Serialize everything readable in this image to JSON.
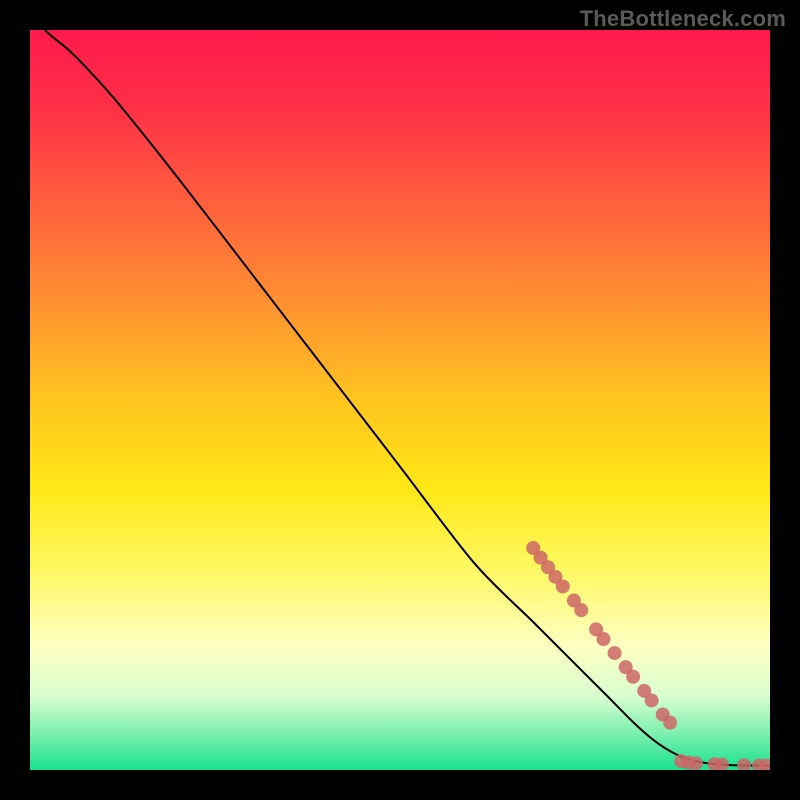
{
  "watermark": "TheBottleneck.com",
  "chart_data": {
    "type": "line",
    "title": "",
    "xlabel": "",
    "ylabel": "",
    "xlim": [
      0,
      100
    ],
    "ylim": [
      0,
      100
    ],
    "background_gradient_stops": [
      {
        "offset": 0.0,
        "color": "#ff1a4b"
      },
      {
        "offset": 0.1,
        "color": "#ff2e47"
      },
      {
        "offset": 0.22,
        "color": "#ff5a3e"
      },
      {
        "offset": 0.35,
        "color": "#ff8a33"
      },
      {
        "offset": 0.5,
        "color": "#ffc41f"
      },
      {
        "offset": 0.62,
        "color": "#ffe816"
      },
      {
        "offset": 0.73,
        "color": "#fff863"
      },
      {
        "offset": 0.83,
        "color": "#ffffc0"
      },
      {
        "offset": 0.9,
        "color": "#d9ffd0"
      },
      {
        "offset": 0.95,
        "color": "#7df0b0"
      },
      {
        "offset": 1.0,
        "color": "#19e28e"
      }
    ],
    "curve": [
      {
        "x": 2,
        "y": 100
      },
      {
        "x": 3,
        "y": 99
      },
      {
        "x": 5,
        "y": 97.5
      },
      {
        "x": 8,
        "y": 94.5
      },
      {
        "x": 12,
        "y": 90
      },
      {
        "x": 20,
        "y": 80
      },
      {
        "x": 30,
        "y": 67
      },
      {
        "x": 40,
        "y": 54
      },
      {
        "x": 50,
        "y": 41
      },
      {
        "x": 60,
        "y": 28
      },
      {
        "x": 68,
        "y": 20
      },
      {
        "x": 74,
        "y": 14
      },
      {
        "x": 78,
        "y": 10
      },
      {
        "x": 82,
        "y": 6
      },
      {
        "x": 85,
        "y": 3.5
      },
      {
        "x": 88,
        "y": 1.8
      },
      {
        "x": 91,
        "y": 1.0
      },
      {
        "x": 94,
        "y": 0.7
      },
      {
        "x": 97,
        "y": 0.6
      },
      {
        "x": 100,
        "y": 0.6
      }
    ],
    "highlight_points": [
      {
        "x": 68,
        "y": 30
      },
      {
        "x": 69,
        "y": 28.7
      },
      {
        "x": 70,
        "y": 27.4
      },
      {
        "x": 71,
        "y": 26.1
      },
      {
        "x": 72,
        "y": 24.8
      },
      {
        "x": 73.5,
        "y": 22.9
      },
      {
        "x": 74.5,
        "y": 21.6
      },
      {
        "x": 76.5,
        "y": 19.0
      },
      {
        "x": 77.5,
        "y": 17.7
      },
      {
        "x": 79,
        "y": 15.8
      },
      {
        "x": 80.5,
        "y": 13.9
      },
      {
        "x": 81.5,
        "y": 12.6
      },
      {
        "x": 83,
        "y": 10.7
      },
      {
        "x": 84,
        "y": 9.4
      },
      {
        "x": 85.5,
        "y": 7.5
      },
      {
        "x": 86.5,
        "y": 6.4
      },
      {
        "x": 88,
        "y": 1.2
      },
      {
        "x": 89,
        "y": 1.0
      },
      {
        "x": 90,
        "y": 0.9
      },
      {
        "x": 92.5,
        "y": 0.8
      },
      {
        "x": 93.5,
        "y": 0.75
      },
      {
        "x": 96.5,
        "y": 0.65
      },
      {
        "x": 98.5,
        "y": 0.6
      },
      {
        "x": 99.5,
        "y": 0.6
      }
    ],
    "highlight_color": "#cc6666",
    "curve_color": "#000000"
  }
}
